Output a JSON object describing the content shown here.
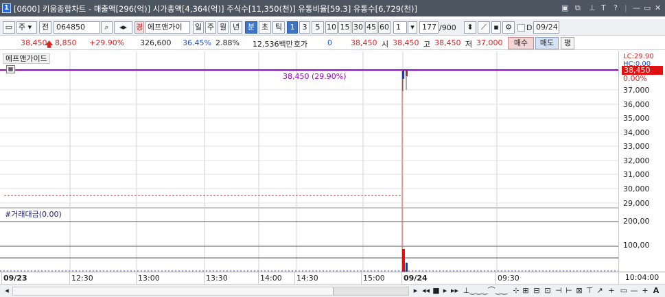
{
  "title": {
    "window_number": "1",
    "text": "[0600] 키움종합차트 - 매출액[296(억)] 시가총액[4,364(억)] 주식수[11,350(천)] 유통비율[59.3] 유통수[6,729(천)]",
    "controls": [
      "▣",
      "⧉",
      "₮",
      "T",
      "?",
      "|",
      "—",
      "▭",
      "✕"
    ]
  },
  "toolbar": {
    "period": "주",
    "prev_label": "전",
    "code": "064850",
    "name_prefix": "경",
    "stock_name": "에프앤가이",
    "intervals": [
      "일",
      "주",
      "월",
      "년",
      "분",
      "초",
      "틱"
    ],
    "selected_interval": "분",
    "minutes": [
      "1",
      "3",
      "5",
      "10",
      "15",
      "30",
      "45",
      "60"
    ],
    "selected_minute": "1",
    "minute_input": "1",
    "count": "177",
    "count_total": "/900",
    "d_label": "D",
    "date": "09/24"
  },
  "price": {
    "current": "38,450",
    "change": "8,850",
    "change_pct": "+29.90%",
    "volume": "326,600",
    "vol_ratio": "36.45%",
    "turnover": "2.88%",
    "amount": "12,536백만",
    "quote_label": "호가",
    "quote": "0",
    "ask": "38,450",
    "open_label": "시",
    "open": "38,450",
    "high_label": "고",
    "high": "38,450",
    "low_label": "저",
    "low": "37,000",
    "buy_label": "매수",
    "sell_label": "매도",
    "avg_label": "평"
  },
  "chart_data": {
    "type": "bar",
    "price_pane": {
      "legend": "에프앤가이드",
      "price_label": "38,450 (29.90%)",
      "current_price": "38,450",
      "lc_label": "LC:29.90",
      "hc_label": "HC:0.00",
      "pct_label": "0.00%",
      "y_ticks": [
        "37,000",
        "36,000",
        "35,000",
        "34,000",
        "33,000",
        "32,000",
        "31,000",
        "30,000",
        "29,000"
      ]
    },
    "volume_pane": {
      "legend": "#거래대금(0.00)",
      "y_ticks": [
        "200,00",
        "100,00"
      ]
    },
    "x_ticks": [
      "09/23",
      "12:30",
      "13:00",
      "13:30",
      "14:00",
      "14:30",
      "15:00",
      "09/24",
      "09:30"
    ],
    "time_readout": "10:04:00",
    "colors": {
      "up": "#e01010",
      "down": "#1030d0",
      "line": "#a000c8",
      "divider": "#e06060"
    }
  }
}
